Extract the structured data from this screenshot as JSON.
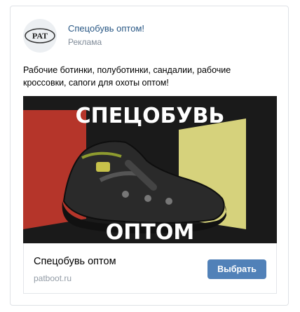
{
  "header": {
    "logo_text": "PAT",
    "sponsor_name": "Спецобувь оптом!",
    "sponsor_tag": "Реклама"
  },
  "post": {
    "text": "Рабочие ботинки, полуботинки, сандалии, рабочие кроссовки, сапоги для охоты оптом!"
  },
  "creative": {
    "headline_top": "СПЕЦОБУВЬ",
    "headline_bottom": "ОПТОМ",
    "colors": {
      "background": "#1a1a1a",
      "red_block": "#b5352a",
      "yellow_block": "#d6d27c",
      "text": "#ffffff"
    }
  },
  "link": {
    "title": "Спецобувь оптом",
    "domain": "patboot.ru",
    "button_label": "Выбрать"
  },
  "colors": {
    "link_blue": "#2a5885",
    "button": "#5181b8",
    "muted": "#818c99"
  }
}
